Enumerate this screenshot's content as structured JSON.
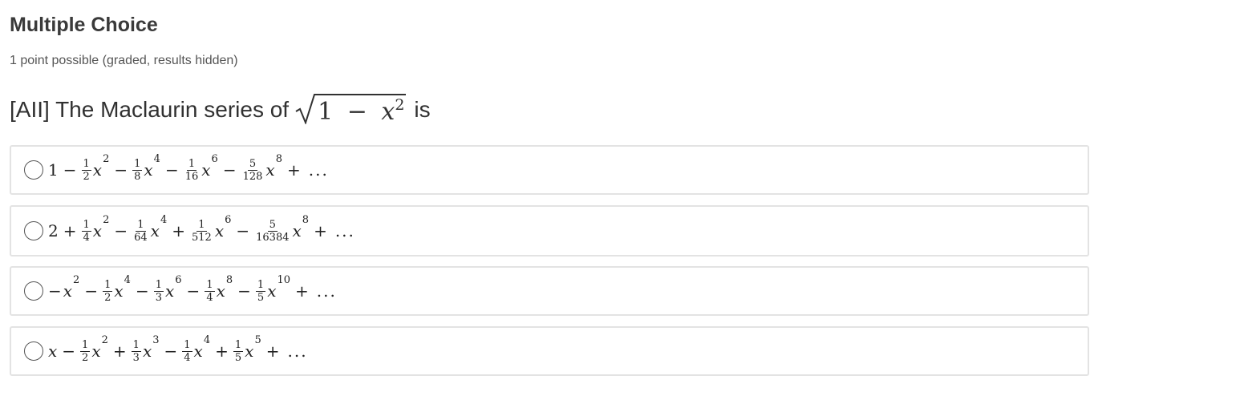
{
  "problem": {
    "title": "Multiple Choice",
    "subtitle": "1 point possible (graded, results hidden)",
    "question": {
      "prefix": "[AII] The Maclaurin series of",
      "radicand_one": "1",
      "radicand_minus": "−",
      "radicand_var": "x",
      "radicand_exp": "2",
      "suffix": "is"
    },
    "choices": [
      {
        "selected": false,
        "terms": [
          {
            "t": "const",
            "v": "1"
          },
          {
            "t": "op",
            "v": "−"
          },
          {
            "t": "frac",
            "num": "1",
            "den": "2"
          },
          {
            "t": "pow",
            "var": "x",
            "exp": "2"
          },
          {
            "t": "op",
            "v": "−"
          },
          {
            "t": "frac",
            "num": "1",
            "den": "8"
          },
          {
            "t": "pow",
            "var": "x",
            "exp": "4"
          },
          {
            "t": "op",
            "v": "−"
          },
          {
            "t": "frac",
            "num": "1",
            "den": "16"
          },
          {
            "t": "pow",
            "var": "x",
            "exp": "6"
          },
          {
            "t": "op",
            "v": "−"
          },
          {
            "t": "frac",
            "num": "5",
            "den": "128"
          },
          {
            "t": "pow",
            "var": "x",
            "exp": "8"
          },
          {
            "t": "op",
            "v": "+"
          },
          {
            "t": "dots",
            "v": "..."
          }
        ]
      },
      {
        "selected": false,
        "terms": [
          {
            "t": "const",
            "v": "2"
          },
          {
            "t": "op",
            "v": "+"
          },
          {
            "t": "frac",
            "num": "1",
            "den": "4"
          },
          {
            "t": "pow",
            "var": "x",
            "exp": "2"
          },
          {
            "t": "op",
            "v": "−"
          },
          {
            "t": "frac",
            "num": "1",
            "den": "64"
          },
          {
            "t": "pow",
            "var": "x",
            "exp": "4"
          },
          {
            "t": "op",
            "v": "+"
          },
          {
            "t": "frac",
            "num": "1",
            "den": "512"
          },
          {
            "t": "pow",
            "var": "x",
            "exp": "6"
          },
          {
            "t": "op",
            "v": "−"
          },
          {
            "t": "frac",
            "num": "5",
            "den": "16384"
          },
          {
            "t": "pow",
            "var": "x",
            "exp": "8"
          },
          {
            "t": "op",
            "v": "+"
          },
          {
            "t": "dots",
            "v": "..."
          }
        ]
      },
      {
        "selected": false,
        "terms": [
          {
            "t": "neg",
            "v": "−"
          },
          {
            "t": "pow",
            "var": "x",
            "exp": "2"
          },
          {
            "t": "op",
            "v": "−"
          },
          {
            "t": "frac",
            "num": "1",
            "den": "2"
          },
          {
            "t": "pow",
            "var": "x",
            "exp": "4"
          },
          {
            "t": "op",
            "v": "−"
          },
          {
            "t": "frac",
            "num": "1",
            "den": "3"
          },
          {
            "t": "pow",
            "var": "x",
            "exp": "6"
          },
          {
            "t": "op",
            "v": "−"
          },
          {
            "t": "frac",
            "num": "1",
            "den": "4"
          },
          {
            "t": "pow",
            "var": "x",
            "exp": "8"
          },
          {
            "t": "op",
            "v": "−"
          },
          {
            "t": "frac",
            "num": "1",
            "den": "5"
          },
          {
            "t": "pow",
            "var": "x",
            "exp": "10"
          },
          {
            "t": "op",
            "v": "+"
          },
          {
            "t": "dots",
            "v": "..."
          }
        ]
      },
      {
        "selected": false,
        "terms": [
          {
            "t": "var",
            "v": "x"
          },
          {
            "t": "op",
            "v": "−"
          },
          {
            "t": "frac",
            "num": "1",
            "den": "2"
          },
          {
            "t": "pow",
            "var": "x",
            "exp": "2"
          },
          {
            "t": "op",
            "v": "+"
          },
          {
            "t": "frac",
            "num": "1",
            "den": "3"
          },
          {
            "t": "pow",
            "var": "x",
            "exp": "3"
          },
          {
            "t": "op",
            "v": "−"
          },
          {
            "t": "frac",
            "num": "1",
            "den": "4"
          },
          {
            "t": "pow",
            "var": "x",
            "exp": "4"
          },
          {
            "t": "op",
            "v": "+"
          },
          {
            "t": "frac",
            "num": "1",
            "den": "5"
          },
          {
            "t": "pow",
            "var": "x",
            "exp": "5"
          },
          {
            "t": "op",
            "v": "+"
          },
          {
            "t": "dots",
            "v": "..."
          }
        ]
      }
    ]
  }
}
